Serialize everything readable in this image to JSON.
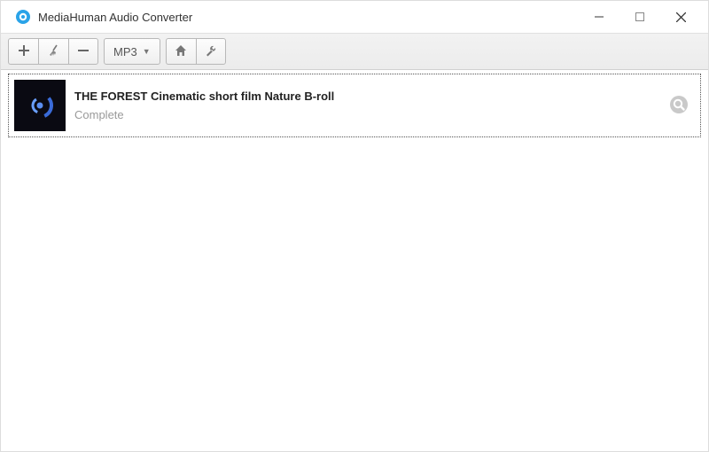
{
  "window": {
    "title": "MediaHuman Audio Converter"
  },
  "toolbar": {
    "format_label": "MP3"
  },
  "items": [
    {
      "title": "THE FOREST Cinematic short film Nature B-roll",
      "status": "Complete"
    }
  ]
}
